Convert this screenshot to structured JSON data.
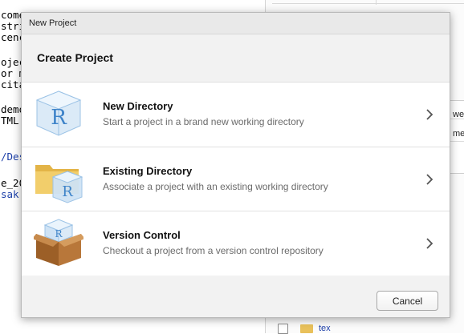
{
  "background": {
    "console_lines": [
      "come",
      "stri",
      "cenc",
      "",
      "ojec",
      "or m",
      "cita",
      "",
      "demo",
      "TML",
      "",
      "/Des",
      "",
      "e_20",
      "sak."
    ],
    "right_panel": {
      "col_frag_1": "we",
      "col_frag_2": "me",
      "file_name": "tex"
    }
  },
  "dialog": {
    "window_title": "New Project",
    "heading": "Create Project",
    "options": [
      {
        "title": "New Directory",
        "description": "Start a project in a brand new working directory",
        "icon": "r-cube-icon"
      },
      {
        "title": "Existing Directory",
        "description": "Associate a project with an existing working directory",
        "icon": "folder-r-icon"
      },
      {
        "title": "Version Control",
        "description": "Checkout a project from a version control repository",
        "icon": "box-r-icon"
      }
    ],
    "cancel_label": "Cancel"
  },
  "colors": {
    "accent_blue": "#4a8fd6",
    "folder_yellow": "#e9c15b",
    "box_brown": "#a86a2e"
  }
}
